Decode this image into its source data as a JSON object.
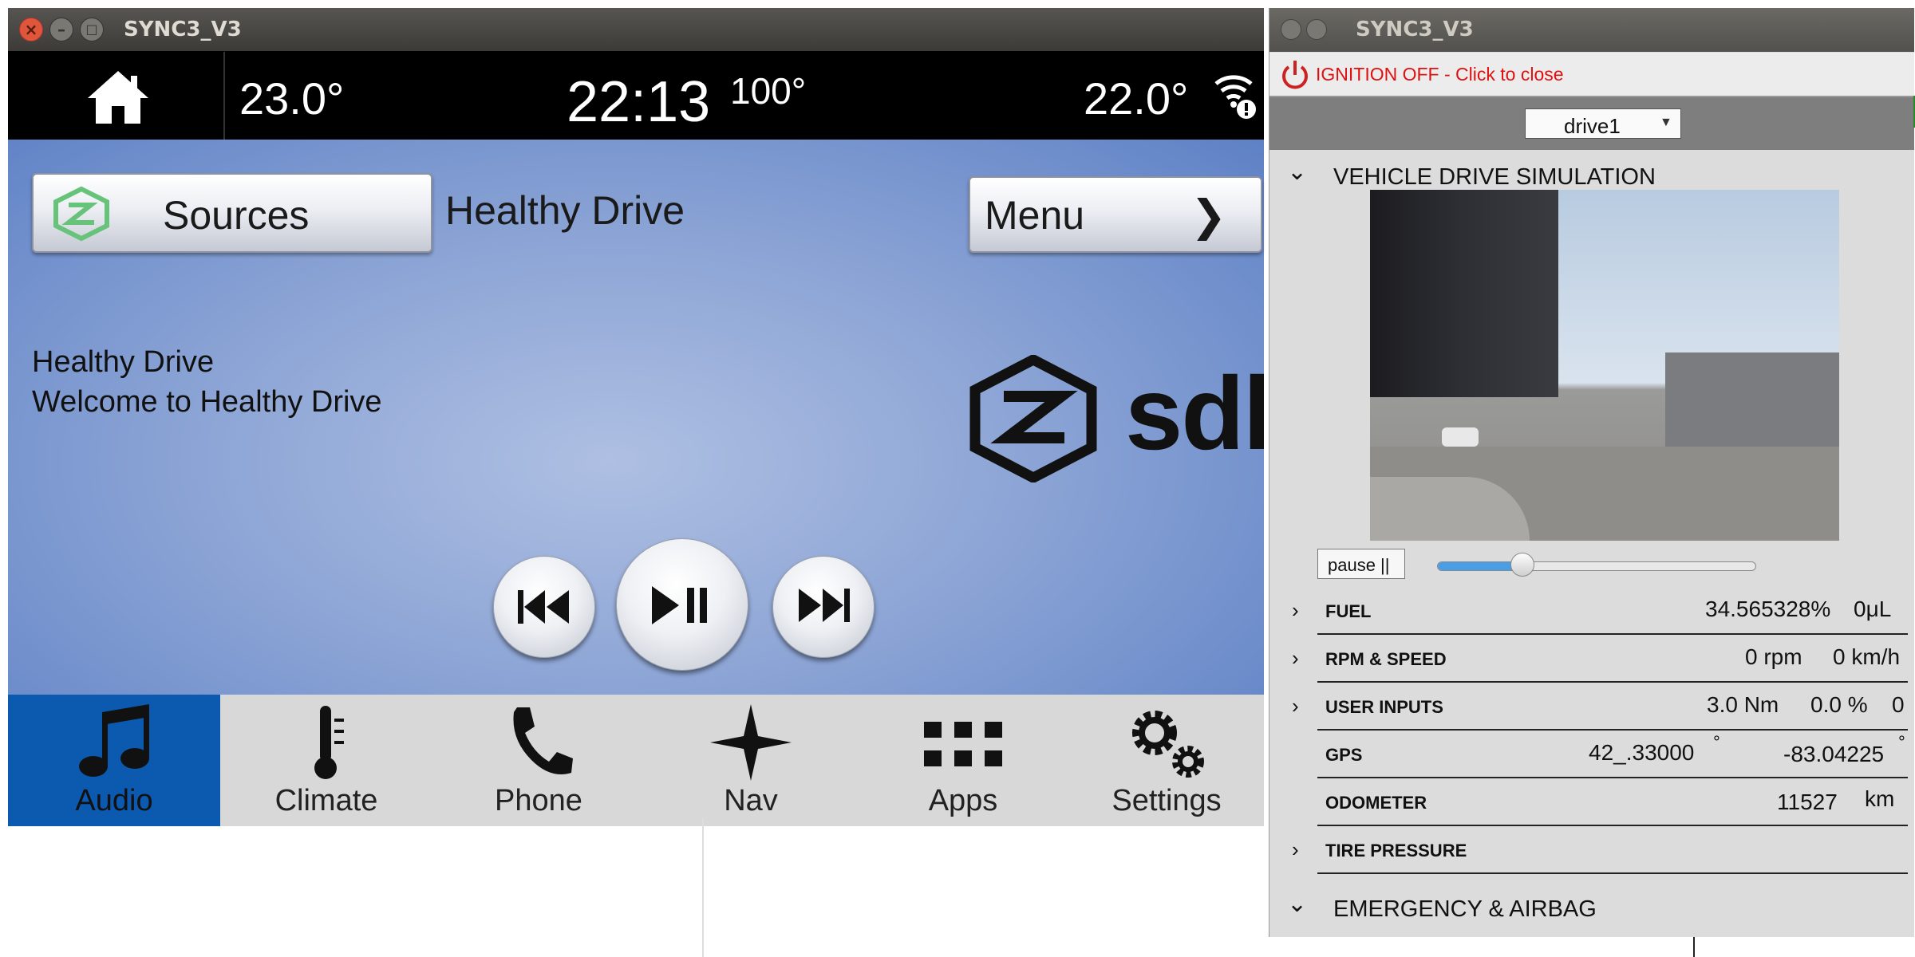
{
  "main_window": {
    "title": "SYNC3_V3",
    "status": {
      "temp_left": "23.0°",
      "clock": "22:13",
      "outside_temp": "100°",
      "temp_right": "22.0°"
    },
    "header": {
      "sources_label": "Sources",
      "app_title": "Healthy Drive",
      "menu_label": "Menu",
      "menu_arrow": "❯"
    },
    "content": {
      "line1": "Healthy Drive",
      "line2": "Welcome to Healthy Drive",
      "logo_text": "sdl"
    },
    "nav": [
      {
        "label": "Audio",
        "icon": "music-note-icon",
        "active": true
      },
      {
        "label": "Climate",
        "icon": "thermometer-icon"
      },
      {
        "label": "Phone",
        "icon": "phone-icon"
      },
      {
        "label": "Nav",
        "icon": "compass-star-icon"
      },
      {
        "label": "Apps",
        "icon": "grid-icon"
      },
      {
        "label": "Settings",
        "icon": "gears-icon"
      }
    ],
    "colors": {
      "accent": "#0b5ab0",
      "nav_bg": "#d8d8d8"
    }
  },
  "side_window": {
    "title": "SYNC3_V3",
    "ignition_label": "IGNITION OFF - Click to close",
    "drive_select": "drive1",
    "simulation_header": "VEHICLE DRIVE SIMULATION",
    "pause_label": "pause ||",
    "playback_progress": 0.27,
    "rows": {
      "fuel": {
        "label": "FUEL",
        "value": "34.565328%",
        "unit": "0μL"
      },
      "rpm": {
        "label": "RPM & SPEED",
        "rpm": "0 rpm",
        "speed": "0 km/h"
      },
      "inputs": {
        "label": "USER INPUTS",
        "torque": "3.0 Nm",
        "pct": "0.0 %",
        "extra": "0"
      },
      "gps": {
        "label": "GPS",
        "lat": "42_.33000",
        "lon": "-83.04225",
        "deg": "°"
      },
      "odometer": {
        "label": "ODOMETER",
        "value": "11527",
        "unit": "km"
      },
      "tire": {
        "label": "TIRE PRESSURE"
      }
    },
    "emergency_header": "EMERGENCY & AIRBAG"
  }
}
